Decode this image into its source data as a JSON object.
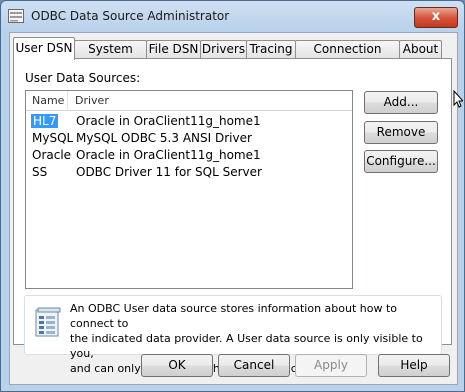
{
  "window": {
    "title": "ODBC Data Source Administrator",
    "close_glyph": "x"
  },
  "tabs": [
    "User DSN",
    "System DSN",
    "File DSN",
    "Drivers",
    "Tracing",
    "Connection Pooling",
    "About"
  ],
  "panel": {
    "group_label": "User Data Sources:",
    "columns": {
      "name": "Name",
      "driver": "Driver"
    },
    "rows": [
      {
        "name": "HL7",
        "driver": "Oracle in OraClient11g_home1"
      },
      {
        "name": "MySQL",
        "driver": "MySQL ODBC 5.3 ANSI Driver"
      },
      {
        "name": "Oracle",
        "driver": "Oracle in OraClient11g_home1"
      },
      {
        "name": "SS",
        "driver": "ODBC Driver 11 for SQL Server"
      }
    ],
    "buttons": {
      "add": "Add...",
      "remove": "Remove",
      "configure": "Configure..."
    },
    "info_lines": [
      "An ODBC User data source stores information about how to connect to",
      "the indicated data provider.   A User data source is only visible to you,",
      "and can only be used on the current machine."
    ]
  },
  "footer": {
    "ok": "OK",
    "cancel": "Cancel",
    "apply": "Apply",
    "help": "Help"
  },
  "colors": {
    "selection": "#3399ff",
    "title_bar": "#b9d1ea",
    "close": "#c13a20"
  }
}
